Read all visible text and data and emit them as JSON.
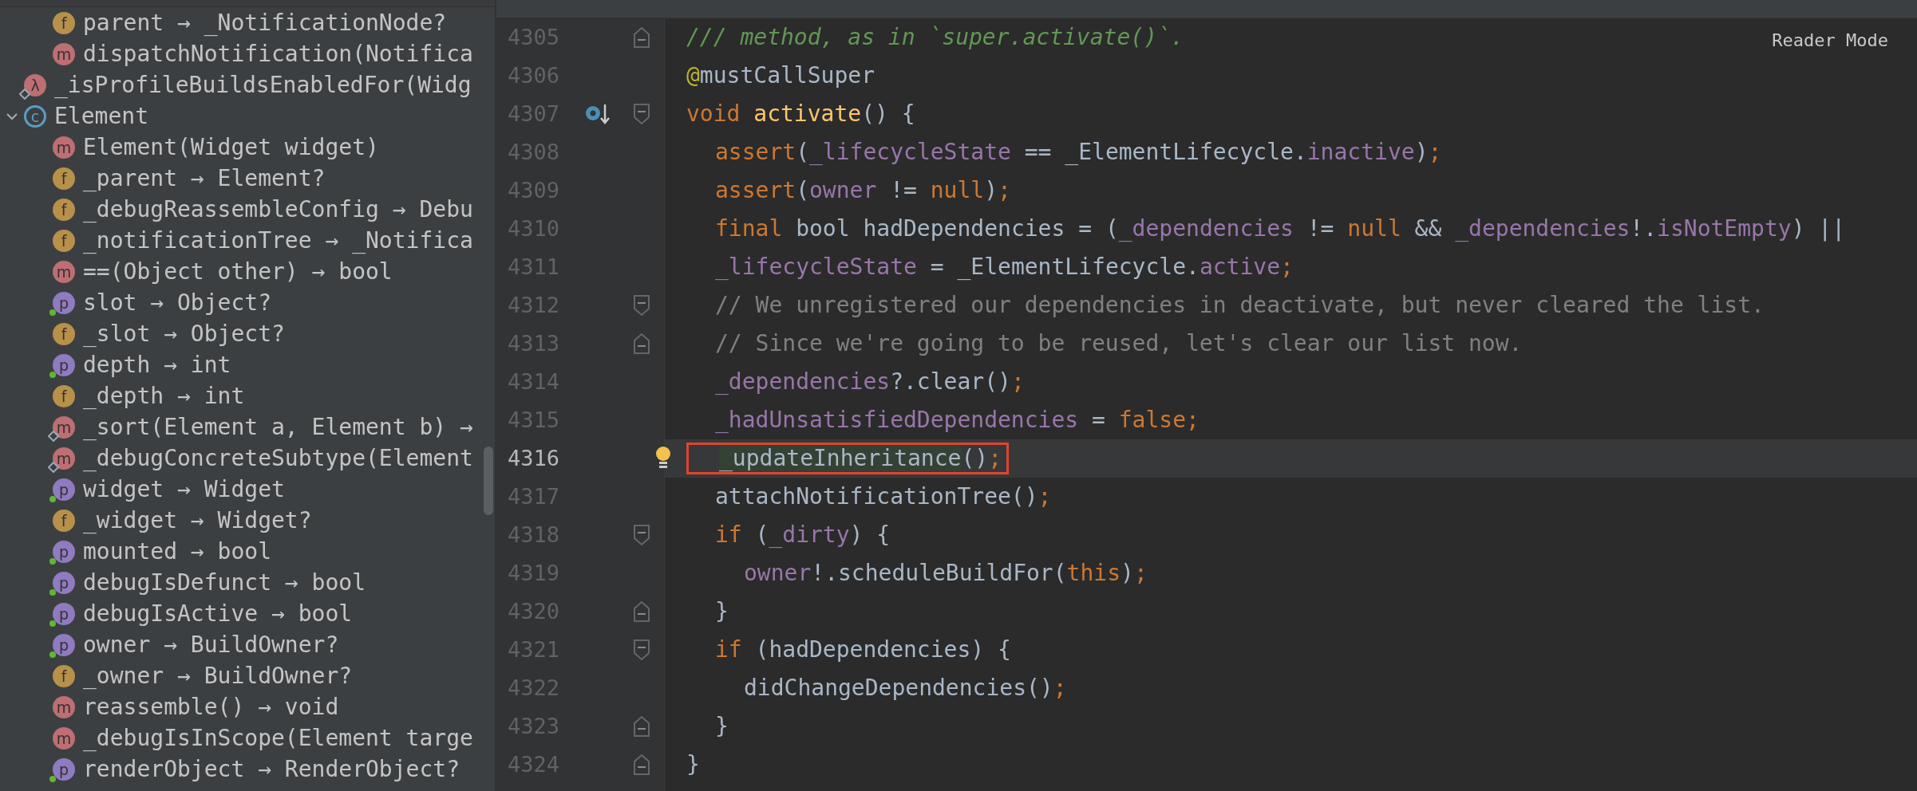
{
  "structure": {
    "continued_children": [
      {
        "label": "parent → _NotificationNode?",
        "kind": "field",
        "badge": "f",
        "dot": false,
        "diamond": false
      },
      {
        "label": "dispatchNotification(Notifica",
        "kind": "method",
        "badge": "m",
        "dot": false,
        "diamond": false
      }
    ],
    "items": [
      {
        "label": "_isProfileBuildsEnabledFor(Widg",
        "kind": "function",
        "badge": "λ",
        "dot": false,
        "diamond": true
      },
      {
        "label": "Element",
        "kind": "class",
        "badge": "c",
        "expanded": true,
        "dot": false,
        "diamond": false,
        "children": [
          {
            "label": "Element(Widget widget)",
            "kind": "method",
            "badge": "m",
            "dot": false,
            "diamond": false
          },
          {
            "label": "_parent → Element?",
            "kind": "field",
            "badge": "f",
            "dot": false,
            "diamond": false
          },
          {
            "label": "_debugReassembleConfig → Debu",
            "kind": "field",
            "badge": "f",
            "dot": false,
            "diamond": false
          },
          {
            "label": "_notificationTree → _Notifica",
            "kind": "field",
            "badge": "f",
            "dot": false,
            "diamond": false
          },
          {
            "label": "==(Object other) → bool",
            "kind": "method",
            "badge": "m",
            "dot": false,
            "diamond": false
          },
          {
            "label": "slot → Object?",
            "kind": "property",
            "badge": "p",
            "dot": true,
            "diamond": false
          },
          {
            "label": "_slot → Object?",
            "kind": "field",
            "badge": "f",
            "dot": false,
            "diamond": false
          },
          {
            "label": "depth → int",
            "kind": "property",
            "badge": "p",
            "dot": true,
            "diamond": false
          },
          {
            "label": "_depth → int",
            "kind": "field",
            "badge": "f",
            "dot": false,
            "diamond": false
          },
          {
            "label": "_sort(Element a, Element b) →",
            "kind": "method",
            "badge": "m",
            "dot": false,
            "diamond": true
          },
          {
            "label": "_debugConcreteSubtype(Element",
            "kind": "method",
            "badge": "m",
            "dot": false,
            "diamond": true
          },
          {
            "label": "widget → Widget",
            "kind": "property",
            "badge": "p",
            "dot": true,
            "diamond": false
          },
          {
            "label": "_widget → Widget?",
            "kind": "field",
            "badge": "f",
            "dot": false,
            "diamond": false
          },
          {
            "label": "mounted → bool",
            "kind": "property",
            "badge": "p",
            "dot": true,
            "diamond": false
          },
          {
            "label": "debugIsDefunct → bool",
            "kind": "property",
            "badge": "p",
            "dot": true,
            "diamond": false
          },
          {
            "label": "debugIsActive → bool",
            "kind": "property",
            "badge": "p",
            "dot": true,
            "diamond": false
          },
          {
            "label": "owner → BuildOwner?",
            "kind": "property",
            "badge": "p",
            "dot": true,
            "diamond": false
          },
          {
            "label": "_owner → BuildOwner?",
            "kind": "field",
            "badge": "f",
            "dot": false,
            "diamond": false
          },
          {
            "label": "reassemble() → void",
            "kind": "method",
            "badge": "m",
            "dot": false,
            "diamond": false
          },
          {
            "label": "_debugIsInScope(Element targe",
            "kind": "method",
            "badge": "m",
            "dot": false,
            "diamond": false
          },
          {
            "label": "renderObject → RenderObject?",
            "kind": "property",
            "badge": "p",
            "dot": true,
            "diamond": false
          }
        ]
      }
    ]
  },
  "editor": {
    "reader_mode": "Reader Mode",
    "lines": [
      {
        "number": "4305",
        "fold_end": true,
        "tokens": [
          {
            "text": "/// method, as in `super.activate()`.",
            "kind": "doc"
          }
        ]
      },
      {
        "number": "4306",
        "tokens": [
          {
            "text": "@",
            "kind": "annotation"
          },
          {
            "text": "mustCallSuper",
            "kind": "plain"
          }
        ]
      },
      {
        "number": "4307",
        "fold_start": true,
        "override_icon": true,
        "tokens": [
          {
            "text": "void ",
            "kind": "keyword"
          },
          {
            "text": "activate",
            "kind": "declaration"
          },
          {
            "text": "() {",
            "kind": "plain"
          }
        ],
        "children": [
          {
            "number": "4308",
            "tokens": [
              {
                "text": "assert",
                "kind": "keyword"
              },
              {
                "text": "(",
                "kind": "plain"
              },
              {
                "text": "_lifecycleState",
                "kind": "field"
              },
              {
                "text": " == _ElementLifecycle.",
                "kind": "plain"
              },
              {
                "text": "inactive",
                "kind": "field"
              },
              {
                "text": ")",
                "kind": "plain"
              },
              {
                "text": ";",
                "kind": "keyword"
              }
            ]
          },
          {
            "number": "4309",
            "tokens": [
              {
                "text": "assert",
                "kind": "keyword"
              },
              {
                "text": "(",
                "kind": "plain"
              },
              {
                "text": "owner",
                "kind": "field"
              },
              {
                "text": " != ",
                "kind": "plain"
              },
              {
                "text": "null",
                "kind": "keyword"
              },
              {
                "text": ")",
                "kind": "plain"
              },
              {
                "text": ";",
                "kind": "keyword"
              }
            ]
          },
          {
            "number": "4310",
            "tokens": [
              {
                "text": "final ",
                "kind": "keyword"
              },
              {
                "text": "bool hadDependencies = (",
                "kind": "plain"
              },
              {
                "text": "_dependencies",
                "kind": "field"
              },
              {
                "text": " != ",
                "kind": "plain"
              },
              {
                "text": "null",
                "kind": "keyword"
              },
              {
                "text": " && ",
                "kind": "plain"
              },
              {
                "text": "_dependencies",
                "kind": "field"
              },
              {
                "text": "!.",
                "kind": "plain"
              },
              {
                "text": "isNotEmpty",
                "kind": "field"
              },
              {
                "text": ") ||",
                "kind": "plain"
              }
            ]
          },
          {
            "number": "4311",
            "tokens": [
              {
                "text": "_lifecycleState",
                "kind": "field"
              },
              {
                "text": " = _ElementLifecycle.",
                "kind": "plain"
              },
              {
                "text": "active",
                "kind": "field"
              },
              {
                "text": ";",
                "kind": "keyword"
              }
            ]
          },
          {
            "number": "4312",
            "fold_start": true,
            "tokens": [
              {
                "text": "// We unregistered our dependencies in deactivate, but never cleared the list.",
                "kind": "comment"
              }
            ]
          },
          {
            "number": "4313",
            "fold_end": true,
            "tokens": [
              {
                "text": "// Since we're going to be reused, let's clear our list now.",
                "kind": "comment"
              }
            ]
          },
          {
            "number": "4314",
            "tokens": [
              {
                "text": "_dependencies",
                "kind": "field"
              },
              {
                "text": "?.clear()",
                "kind": "plain"
              },
              {
                "text": ";",
                "kind": "keyword"
              }
            ]
          },
          {
            "number": "4315",
            "tokens": [
              {
                "text": "_hadUnsatisfiedDependencies",
                "kind": "field"
              },
              {
                "text": " = ",
                "kind": "plain"
              },
              {
                "text": "false",
                "kind": "keyword"
              },
              {
                "text": ";",
                "kind": "keyword"
              }
            ]
          },
          {
            "number": "4316",
            "current": true,
            "boxed": true,
            "intention_bulb": true,
            "tokens": [
              {
                "text": "_updateInheritance",
                "kind": "usage"
              },
              {
                "text": "()",
                "kind": "plain"
              },
              {
                "text": ";",
                "kind": "keyword"
              }
            ]
          },
          {
            "number": "4317",
            "tokens": [
              {
                "text": "attachNotificationTree()",
                "kind": "plain"
              },
              {
                "text": ";",
                "kind": "keyword"
              }
            ]
          },
          {
            "number": "4318",
            "fold_start": true,
            "tokens": [
              {
                "text": "if ",
                "kind": "keyword"
              },
              {
                "text": "(",
                "kind": "plain"
              },
              {
                "text": "_dirty",
                "kind": "field"
              },
              {
                "text": ") {",
                "kind": "plain"
              }
            ],
            "children": [
              {
                "number": "4319",
                "tokens": [
                  {
                    "text": "owner",
                    "kind": "field"
                  },
                  {
                    "text": "!.scheduleBuildFor(",
                    "kind": "plain"
                  },
                  {
                    "text": "this",
                    "kind": "keyword"
                  },
                  {
                    "text": ")",
                    "kind": "plain"
                  },
                  {
                    "text": ";",
                    "kind": "keyword"
                  }
                ]
              }
            ]
          },
          {
            "number": "4320",
            "fold_end": true,
            "tokens": [
              {
                "text": "}",
                "kind": "plain"
              }
            ]
          },
          {
            "number": "4321",
            "fold_start": true,
            "tokens": [
              {
                "text": "if ",
                "kind": "keyword"
              },
              {
                "text": "(hadDependencies) {",
                "kind": "plain"
              }
            ],
            "children": [
              {
                "number": "4322",
                "tokens": [
                  {
                    "text": "didChangeDependencies()",
                    "kind": "plain"
                  },
                  {
                    "text": ";",
                    "kind": "keyword"
                  }
                ]
              }
            ]
          },
          {
            "number": "4323",
            "fold_end": true,
            "tokens": [
              {
                "text": "}",
                "kind": "plain"
              }
            ]
          }
        ]
      },
      {
        "number": "4324",
        "fold_end": true,
        "tokens": [
          {
            "text": "}",
            "kind": "plain"
          }
        ]
      }
    ]
  }
}
